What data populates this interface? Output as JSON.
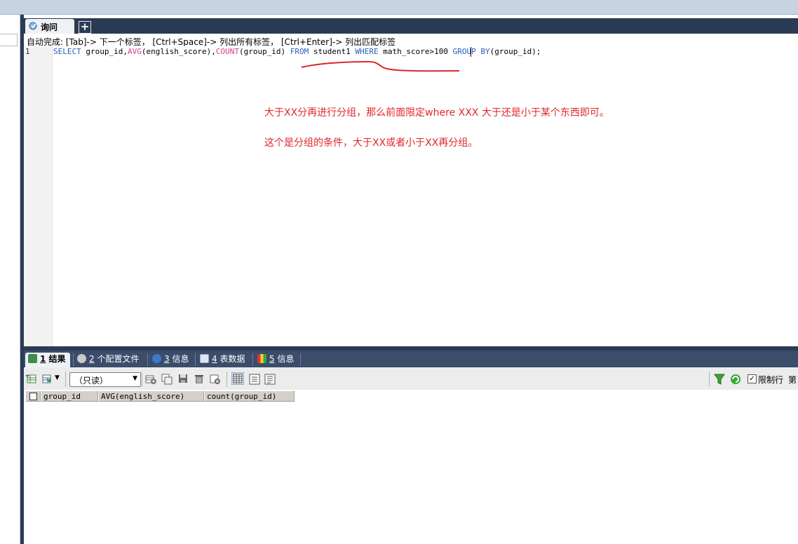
{
  "query_tab": {
    "label": "询问",
    "new_tab": "+"
  },
  "hint": "自动完成: [Tab]-> 下一个标签， [Ctrl+Space]-> 列出所有标签， [Ctrl+Enter]-> 列出匹配标签",
  "editor": {
    "line_number": "1",
    "sql": [
      {
        "t": "SELECT",
        "c": "kw"
      },
      {
        "t": " group_id,",
        "c": ""
      },
      {
        "t": "AVG",
        "c": "fn"
      },
      {
        "t": "(english_score),",
        "c": ""
      },
      {
        "t": "COUNT",
        "c": "fn"
      },
      {
        "t": "(group_id) ",
        "c": ""
      },
      {
        "t": "FROM",
        "c": "kw"
      },
      {
        "t": " student1 ",
        "c": ""
      },
      {
        "t": "WHERE",
        "c": "kw"
      },
      {
        "t": " math_score>100 ",
        "c": ""
      },
      {
        "t": "GROUP BY",
        "c": "kw"
      },
      {
        "t": "(group_id);",
        "c": ""
      }
    ]
  },
  "annotations": {
    "note1": "大于XX分再进行分组，那么前面限定where XXX 大于还是小于某个东西即可。",
    "note2": "这个是分组的条件，大于XX或者小于XX再分组。",
    "underline_color": "#e0262a"
  },
  "result_tabs": [
    {
      "num": "1",
      "label": "结果",
      "icon": "grid-icon",
      "active": true
    },
    {
      "num": "2",
      "label": "个配置文件",
      "icon": "profile-icon",
      "active": false
    },
    {
      "num": "3",
      "label": "信息",
      "icon": "info-icon",
      "active": false
    },
    {
      "num": "4",
      "label": "表数据",
      "icon": "table-data-icon",
      "active": false
    },
    {
      "num": "5",
      "label": "信息",
      "icon": "info-colored-icon",
      "active": false
    }
  ],
  "toolbar": {
    "readonly_select": "（只读）",
    "limit_checked": true,
    "limit_label": "限制行",
    "page_label": "第"
  },
  "grid": {
    "columns": [
      "group_id",
      "AVG(english_score)",
      "count(group_id)"
    ]
  },
  "colors": {
    "dark_bar": "#2b3b55",
    "keyword": "#2b5cb8",
    "function": "#d43c8c",
    "annotation": "#e0262a"
  }
}
